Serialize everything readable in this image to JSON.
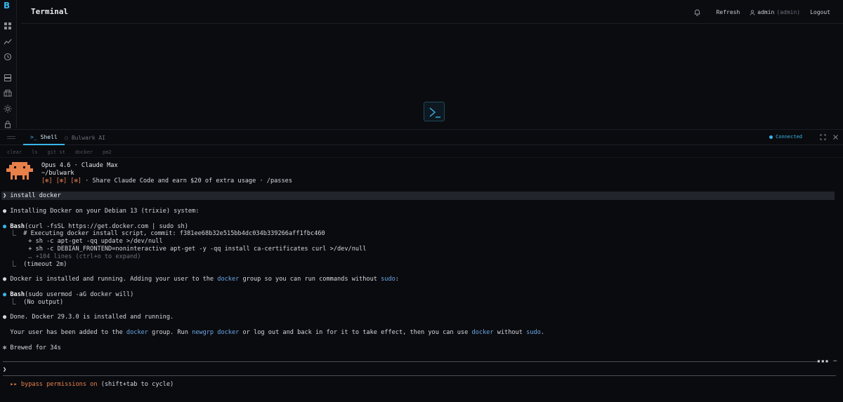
{
  "app": {
    "brand_letter": "B"
  },
  "sidebar": {
    "icons": [
      "grid-icon",
      "chart-icon",
      "clock-icon",
      "server-icon",
      "container-icon",
      "sun-icon",
      "lock-icon"
    ]
  },
  "header": {
    "title": "Terminal",
    "refresh_label": "Refresh",
    "user_name": "admin",
    "user_role": "(admin)",
    "logout_label": "Logout"
  },
  "panel": {
    "tabs": [
      {
        "label": "Shell",
        "glyph": ">_",
        "active": true
      },
      {
        "label": "Bulwark AI",
        "glyph": "○",
        "active": false
      }
    ],
    "status": "Connected",
    "quick_commands": [
      "clear",
      "ls",
      "git st",
      "docker",
      "pm2"
    ]
  },
  "terminal": {
    "banner": {
      "model": "Opus 4.6 · Claude Max",
      "cwd": "~/bulwark",
      "passes_prefix": "[✻] [✻] [✻]",
      "passes_text": " · Share Claude Code and earn $20 of extra usage · /passes"
    },
    "user_prompt": "❯ install docker",
    "lines": {
      "l1": "● Installing Docker on your Debian 13 (trixie) system:",
      "bash1_bullet": "●",
      "bash1_name": "Bash",
      "bash1_cmd": "(curl -fsSL https://get.docker.com | sudo sh)",
      "out1": "  ⎿  # Executing docker install script, commit: f381ee68b32e515bb4dc034b339266aff1fbc460",
      "out2": "       + sh -c apt-get -qq update >/dev/null",
      "out3": "       + sh -c DEBIAN_FRONTEND=noninteractive apt-get -y -qq install ca-certificates curl >/dev/null",
      "out4": "       … +104 lines (ctrl+o to expand)",
      "out5": "  ⎿  (timeout 2m)",
      "l2a": "● Docker is installed and running. Adding your user to the ",
      "l2b": "docker",
      "l2c": " group so you can run commands without ",
      "l2d": "sudo",
      "l2e": ":",
      "bash2_bullet": "●",
      "bash2_name": "Bash",
      "bash2_cmd": "(sudo usermod -aG docker will)",
      "out6": "  ⎿  (No output)",
      "l3": "● Done. Docker 29.3.0 is installed and running.",
      "l4a": "  Your user has been added to the ",
      "l4b": "docker",
      "l4c": " group. Run ",
      "l4d": "newgrp docker",
      "l4e": " or log out and back in for it to take effect, then you can use ",
      "l4f": "docker",
      "l4g": " without ",
      "l4h": "sudo",
      "l4i": ".",
      "brewed": "✻ Brewed for 34s",
      "rule_tail": "▪▪▪ ─",
      "input_prompt": "❯",
      "mode_prefix": "  ▸▸ bypass permissions on",
      "mode_suffix": " (shift+tab to cycle)"
    }
  },
  "colors": {
    "accent": "#37b6e8",
    "link": "#6aa8e8",
    "warning": "#e8804a",
    "background": "#0b0c10"
  }
}
